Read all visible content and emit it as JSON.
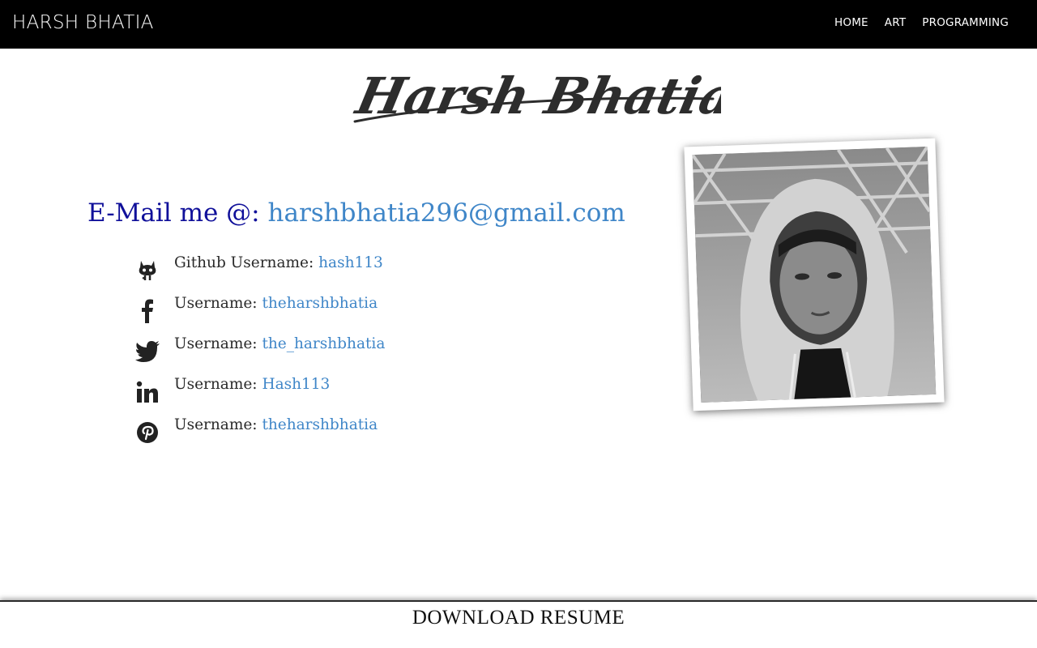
{
  "navbar": {
    "brand": "HARSH BHATIA",
    "links": [
      "HOME",
      "ART",
      "PROGRAMMING"
    ]
  },
  "signature": "Harsh Bhatia",
  "email": {
    "label": "E-Mail me @:",
    "address": "harshbhatia296@gmail.com"
  },
  "social": [
    {
      "icon": "github-icon",
      "label": "Github Username:",
      "handle": "hash113"
    },
    {
      "icon": "facebook-icon",
      "label": "Username:",
      "handle": "theharshbhatia"
    },
    {
      "icon": "twitter-icon",
      "label": "Username:",
      "handle": "the_harshbhatia"
    },
    {
      "icon": "linkedin-icon",
      "label": "Username:",
      "handle": "Hash113"
    },
    {
      "icon": "pinterest-icon",
      "label": "Username:",
      "handle": "theharshbhatia"
    }
  ],
  "footer": {
    "resume_label": "DOWNLOAD RESUME"
  },
  "colors": {
    "navbar_bg": "#000000",
    "email_label": "#10109a",
    "link": "#3f86c8"
  }
}
